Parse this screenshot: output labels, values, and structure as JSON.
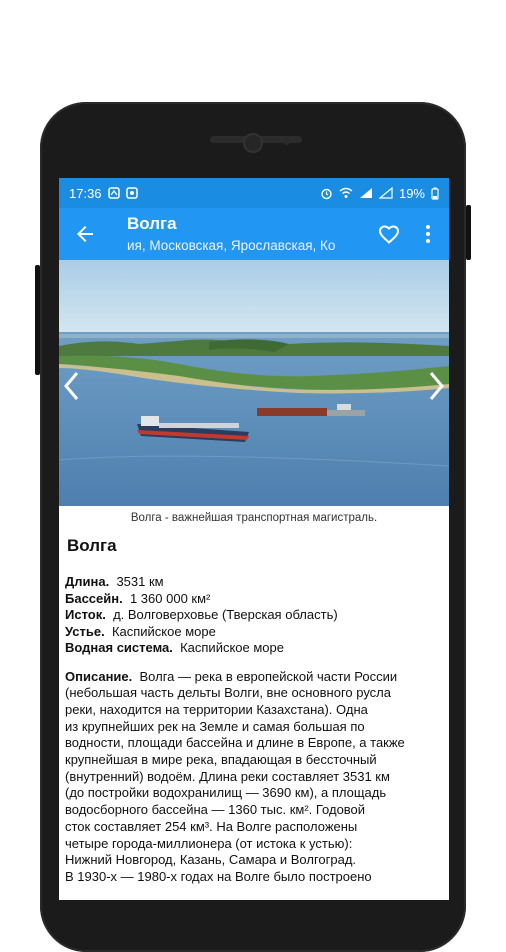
{
  "status": {
    "time": "17:36",
    "battery": "19%"
  },
  "toolbar": {
    "title": "Волга",
    "subtitle": "ия, Московская, Ярославская, Ко"
  },
  "photo": {
    "caption": "Волга - важнейшая транспортная магистраль."
  },
  "article": {
    "heading": "Волга",
    "facts": [
      {
        "label": "Длина.",
        "value": "3531 км"
      },
      {
        "label": "Бассейн.",
        "value": "1 360 000 км²"
      },
      {
        "label": "Исток.",
        "value": "д. Волговерховье (Тверская область)"
      },
      {
        "label": "Устье.",
        "value": "Каспийское море"
      },
      {
        "label": "Водная система.",
        "value": "Каспийское море"
      }
    ],
    "description_label": "Описание.",
    "description_lines": [
      "Волга — река в европейской части России",
      "(небольшая часть дельты Волги, вне основного русла",
      "реки, находится на территории Казахстана). Одна",
      "из крупнейших рек на Земле и самая большая по",
      "водности, площади бассейна и длине в Европе, а также",
      "крупнейшая в мире река, впадающая в бессточный",
      "(внутренний) водоём. Длина реки составляет 3531 км",
      "(до постройки водохранилищ — 3690 км), а площадь",
      "водосборного бассейна — 1360 тыс. км². Годовой",
      "сток составляет 254 км³. На Волге расположены",
      "четыре города-миллионера (от истока к устью):",
      "Нижний Новгород, Казань, Самара и Волгоград.",
      "В 1930-х — 1980-х годах на Волге было построено"
    ]
  },
  "colors": {
    "statusbar": "#1a8de2",
    "toolbar": "#2196f3"
  },
  "icons": [
    "back-arrow-icon",
    "heart-outline-icon",
    "more-vert-icon",
    "chevron-left-icon",
    "chevron-right-icon"
  ]
}
